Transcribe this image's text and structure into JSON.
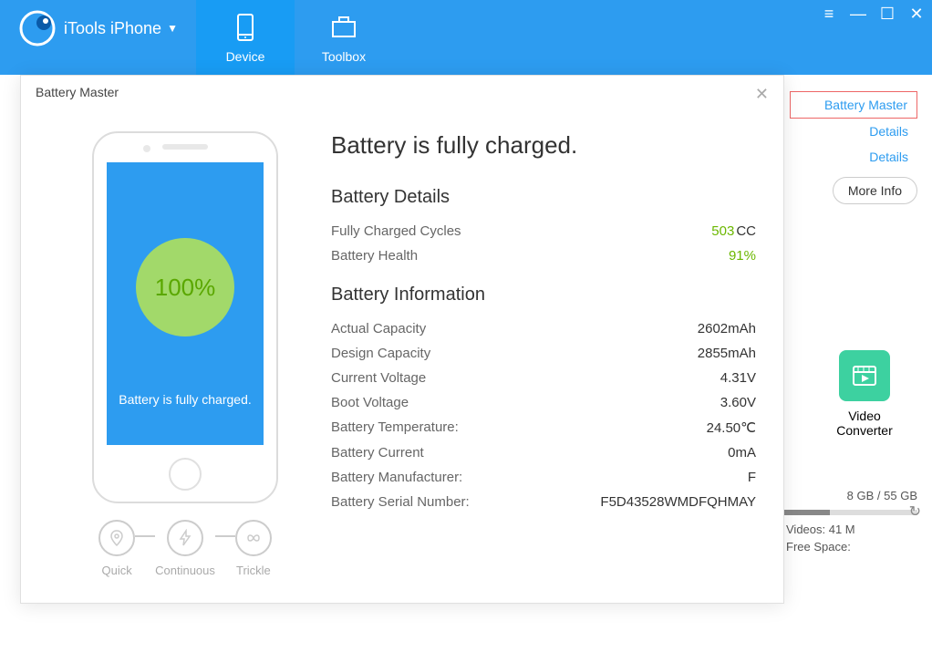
{
  "app": {
    "title": "iTools iPhone",
    "tabs": {
      "device": "Device",
      "toolbox": "Toolbox"
    }
  },
  "side": {
    "battery_master": "Battery Master",
    "details": "Details",
    "more_info": "More Info",
    "video_converter": "Video Converter",
    "storage_text": "8 GB / 55 GB",
    "legend_videos": "Videos: 41 M",
    "legend_free": "Free Space:"
  },
  "modal": {
    "title": "Battery Master",
    "phone_pct": "100%",
    "phone_status": "Battery is fully charged.",
    "modes": {
      "quick": "Quick",
      "continuous": "Continuous",
      "trickle": "Trickle"
    },
    "heading": "Battery is fully charged.",
    "sub_details": "Battery Details",
    "row_cycles_label": "Fully Charged Cycles",
    "row_cycles_val": "503",
    "row_cycles_unit": "CC",
    "row_health_label": "Battery Health",
    "row_health_val": "91%",
    "sub_info": "Battery Information",
    "rows": [
      {
        "label": "Actual Capacity",
        "val": "2602mAh"
      },
      {
        "label": "Design Capacity",
        "val": "2855mAh"
      },
      {
        "label": "Current Voltage",
        "val": "4.31V"
      },
      {
        "label": "Boot Voltage",
        "val": "3.60V"
      },
      {
        "label": "Battery Temperature:",
        "val": "24.50℃"
      },
      {
        "label": "Battery Current",
        "val": "0mA"
      },
      {
        "label": "Battery Manufacturer:",
        "val": "F"
      },
      {
        "label": "Battery Serial Number:",
        "val": "F5D43528WMDFQHMAY"
      }
    ]
  }
}
